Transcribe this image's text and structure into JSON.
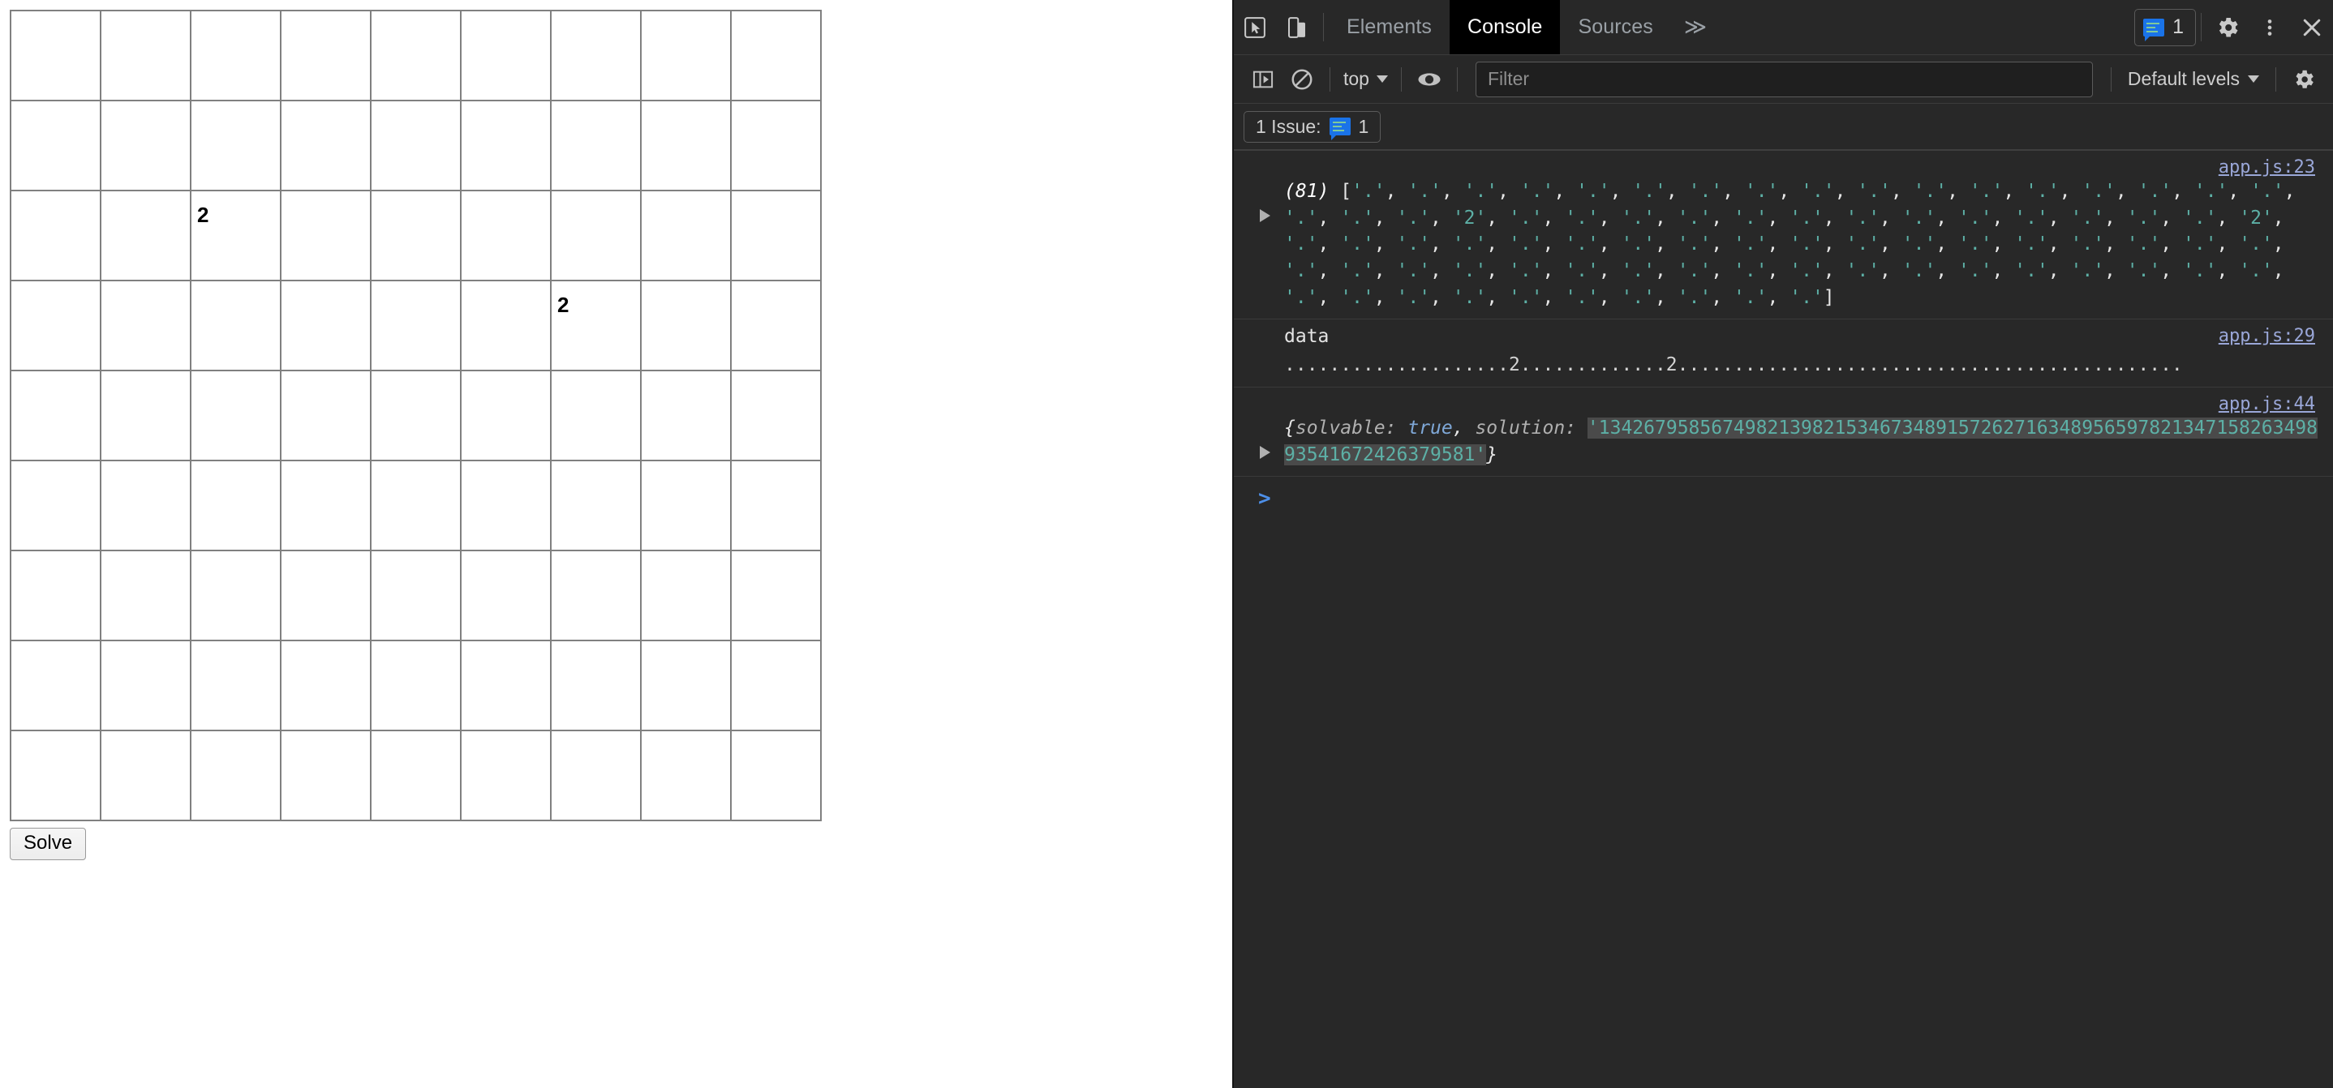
{
  "page": {
    "grid": {
      "rows": 9,
      "cols": 9,
      "cells": [
        [
          "",
          "",
          "",
          "",
          "",
          "",
          "",
          "",
          ""
        ],
        [
          "",
          "",
          "",
          "",
          "",
          "",
          "",
          "",
          ""
        ],
        [
          "",
          "",
          "2",
          "",
          "",
          "",
          "",
          "",
          ""
        ],
        [
          "",
          "",
          "",
          "",
          "",
          "",
          "2",
          "",
          ""
        ],
        [
          "",
          "",
          "",
          "",
          "",
          "",
          "",
          "",
          ""
        ],
        [
          "",
          "",
          "",
          "",
          "",
          "",
          "",
          "",
          ""
        ],
        [
          "",
          "",
          "",
          "",
          "",
          "",
          "",
          "",
          ""
        ],
        [
          "",
          "",
          "",
          "",
          "",
          "",
          "",
          "",
          ""
        ],
        [
          "",
          "",
          "",
          "",
          "",
          "",
          "",
          "",
          ""
        ]
      ]
    },
    "solve_button": "Solve"
  },
  "devtools": {
    "tabs": [
      {
        "label": "Elements",
        "active": false
      },
      {
        "label": "Console",
        "active": true
      },
      {
        "label": "Sources",
        "active": false
      }
    ],
    "more_tabs_glyph": "≫",
    "icons": {
      "inspect": "inspect-element-icon",
      "device": "device-toolbar-icon",
      "settings": "gear-icon",
      "kebab": "more-options-icon",
      "close": "close-icon",
      "sidebar": "console-sidebar-icon",
      "clear": "clear-console-icon",
      "eye": "live-expression-icon",
      "settings2": "console-settings-icon",
      "message": "message-icon"
    },
    "issues_badge_count": "1",
    "toolbar": {
      "context": "top",
      "filter_placeholder": "Filter",
      "filter_value": "",
      "levels": "Default levels"
    },
    "issues_bar": {
      "label": "1 Issue:",
      "count": "1"
    },
    "messages": [
      {
        "id": "array-log",
        "source": "app.js:23",
        "expandable": true,
        "count_prefix": "(81)",
        "open_bracket": "[",
        "close_bracket": "]",
        "array_values": [
          ".",
          ".",
          ".",
          ".",
          ".",
          ".",
          ".",
          ".",
          ".",
          ".",
          ".",
          ".",
          ".",
          ".",
          ".",
          ".",
          ".",
          ".",
          ".",
          ".",
          "2",
          ".",
          ".",
          ".",
          ".",
          ".",
          ".",
          ".",
          ".",
          ".",
          ".",
          ".",
          ".",
          ".",
          "2",
          ".",
          ".",
          ".",
          ".",
          ".",
          ".",
          ".",
          ".",
          ".",
          ".",
          ".",
          ".",
          ".",
          ".",
          ".",
          ".",
          ".",
          ".",
          ".",
          ".",
          ".",
          ".",
          ".",
          ".",
          ".",
          ".",
          ".",
          ".",
          ".",
          ".",
          ".",
          ".",
          ".",
          ".",
          ".",
          ".",
          ".",
          ".",
          ".",
          ".",
          ".",
          ".",
          ".",
          ".",
          ".",
          "."
        ]
      },
      {
        "id": "data-log",
        "source": "app.js:29",
        "expandable": false,
        "label": "data",
        "text": "....................2.............2............................................."
      },
      {
        "id": "result-log",
        "source": "app.js:44",
        "expandable": true,
        "object": {
          "open": "{",
          "key1": "solvable:",
          "value1": "true",
          "comma": ",",
          "key2": "solution:",
          "value2": "'134267958567498213982153467348915726271634895659782134715826349893541672426379581'",
          "close": "}"
        }
      }
    ],
    "prompt": ">"
  }
}
